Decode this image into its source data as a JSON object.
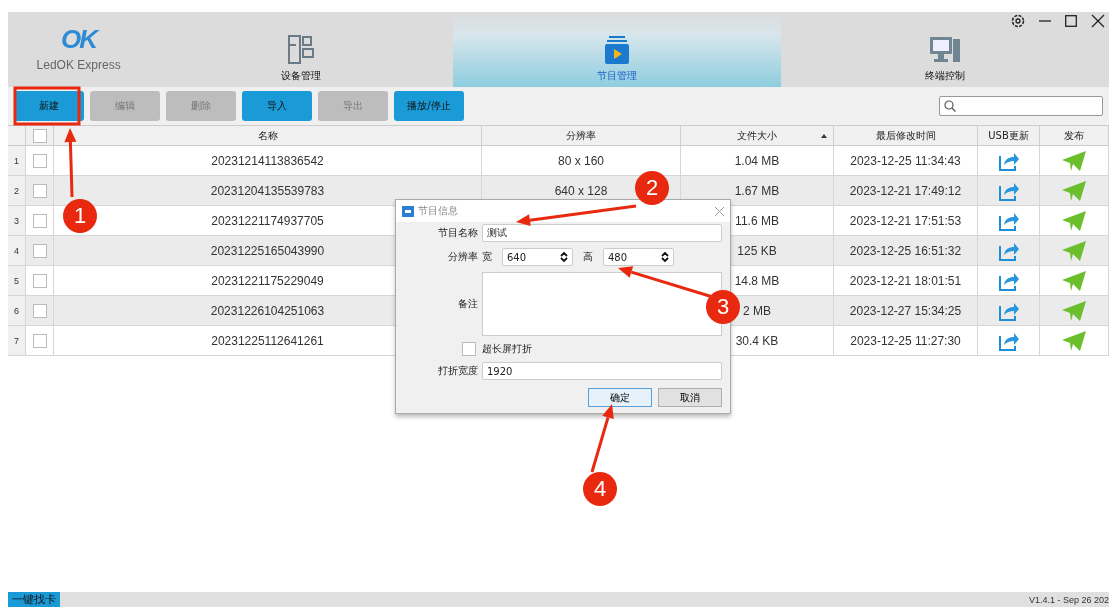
{
  "app": {
    "logo_mark": "OK",
    "name": "LedOK Express"
  },
  "nav_tabs": [
    {
      "label": "设备管理",
      "kind": "device",
      "selected": false
    },
    {
      "label": "节目管理",
      "kind": "program",
      "selected": true
    },
    {
      "label": "终端控制",
      "kind": "terminal",
      "selected": false
    }
  ],
  "toolbar": [
    {
      "label": "新建",
      "disabled": false
    },
    {
      "label": "编辑",
      "disabled": true
    },
    {
      "label": "删除",
      "disabled": true
    },
    {
      "label": "导入",
      "disabled": false
    },
    {
      "label": "导出",
      "disabled": true
    },
    {
      "label": "播放/停止",
      "disabled": false
    }
  ],
  "table": {
    "all_checked": false,
    "columns": [
      "名称",
      "分辨率",
      "文件大小",
      "最后修改时间",
      "USB更新",
      "发布"
    ],
    "rows": [
      {
        "index": "1",
        "checked": false,
        "name": "20231214113836542",
        "resolution": "80 x 160",
        "size": "1.04 MB",
        "modified": "2023-12-25 11:34:43"
      },
      {
        "index": "2",
        "checked": false,
        "name": "20231204135539783",
        "resolution": "640 x 128",
        "size": "1.67 MB",
        "modified": "2023-12-21 17:49:12"
      },
      {
        "index": "3",
        "checked": false,
        "name": "20231221174937705",
        "size": "11.6 MB",
        "modified": "2023-12-21 17:51:53"
      },
      {
        "index": "4",
        "checked": false,
        "name": "20231225165043990",
        "size": "125 KB",
        "modified": "2023-12-25 16:51:32"
      },
      {
        "index": "5",
        "checked": false,
        "name": "20231221175229049",
        "size": "14.8 MB",
        "modified": "2023-12-21 18:01:51"
      },
      {
        "index": "6",
        "checked": false,
        "name": "20231226104251063",
        "size": "2 MB",
        "modified": "2023-12-27 15:34:25"
      },
      {
        "index": "7",
        "checked": false,
        "name": "20231225112641261",
        "size": "30.4 KB",
        "modified": "2023-12-25 11:27:30"
      }
    ]
  },
  "dialog": {
    "title": "节目信息",
    "name_label": "节目名称",
    "name_value": "测试",
    "resolution_label": "分辨率",
    "width_label": "宽",
    "width_value": "640",
    "height_label": "高",
    "height_value": "480",
    "note_label": "备注",
    "fold_label": "超长屏打折",
    "fold_checked": false,
    "fold_width_label": "打折宽度",
    "fold_width_value": "1920",
    "buttons": [
      "确定",
      "取消"
    ]
  },
  "status_bar": {
    "button": "一键找卡",
    "version": "V1.4.1 - Sep 26 202"
  },
  "annotations": [
    "1",
    "2",
    "3",
    "4"
  ]
}
